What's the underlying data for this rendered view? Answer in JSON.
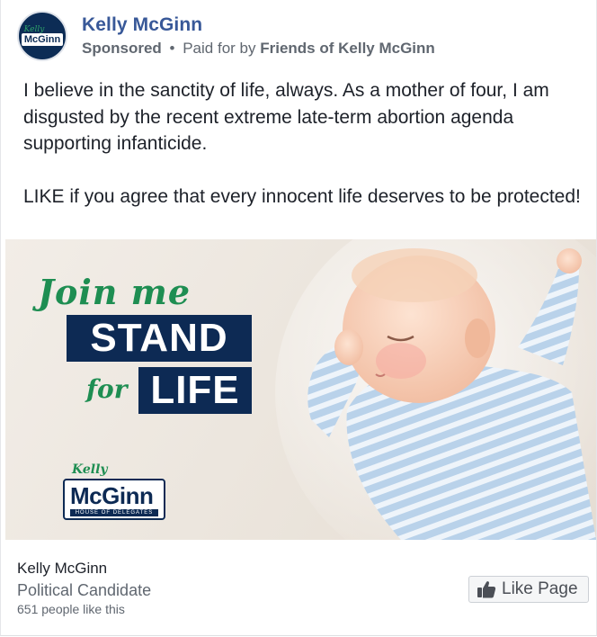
{
  "post": {
    "author": "Kelly McGinn",
    "sponsored_label": "Sponsored",
    "separator": "•",
    "paid_for_prefix": "Paid for by",
    "paid_for_by": "Friends of Kelly McGinn",
    "avatar_kelly": "Kelly",
    "avatar_mcginn": "McGinn",
    "text_paragraph_1": "I believe in the sanctity of life, always. As a mother of four, I am disgusted by the recent extreme late-term abortion agenda supporting infanticide.",
    "text_paragraph_2": "LIKE if you agree that every innocent life deserves to be protected!"
  },
  "ad_image": {
    "join_me": "Join me",
    "stand": "STAND",
    "for": "for",
    "life": "LIFE",
    "logo_kelly": "Kelly",
    "logo_name": "McGinn",
    "logo_sub": "HOUSE OF DELEGATES"
  },
  "footer": {
    "page_name": "Kelly McGinn",
    "page_category": "Political Candidate",
    "likes": "651 people like this",
    "like_button": "Like Page"
  },
  "colors": {
    "link_blue": "#385898",
    "navy": "#0d2a54",
    "green": "#1e8e52",
    "gray_text": "#606770"
  }
}
